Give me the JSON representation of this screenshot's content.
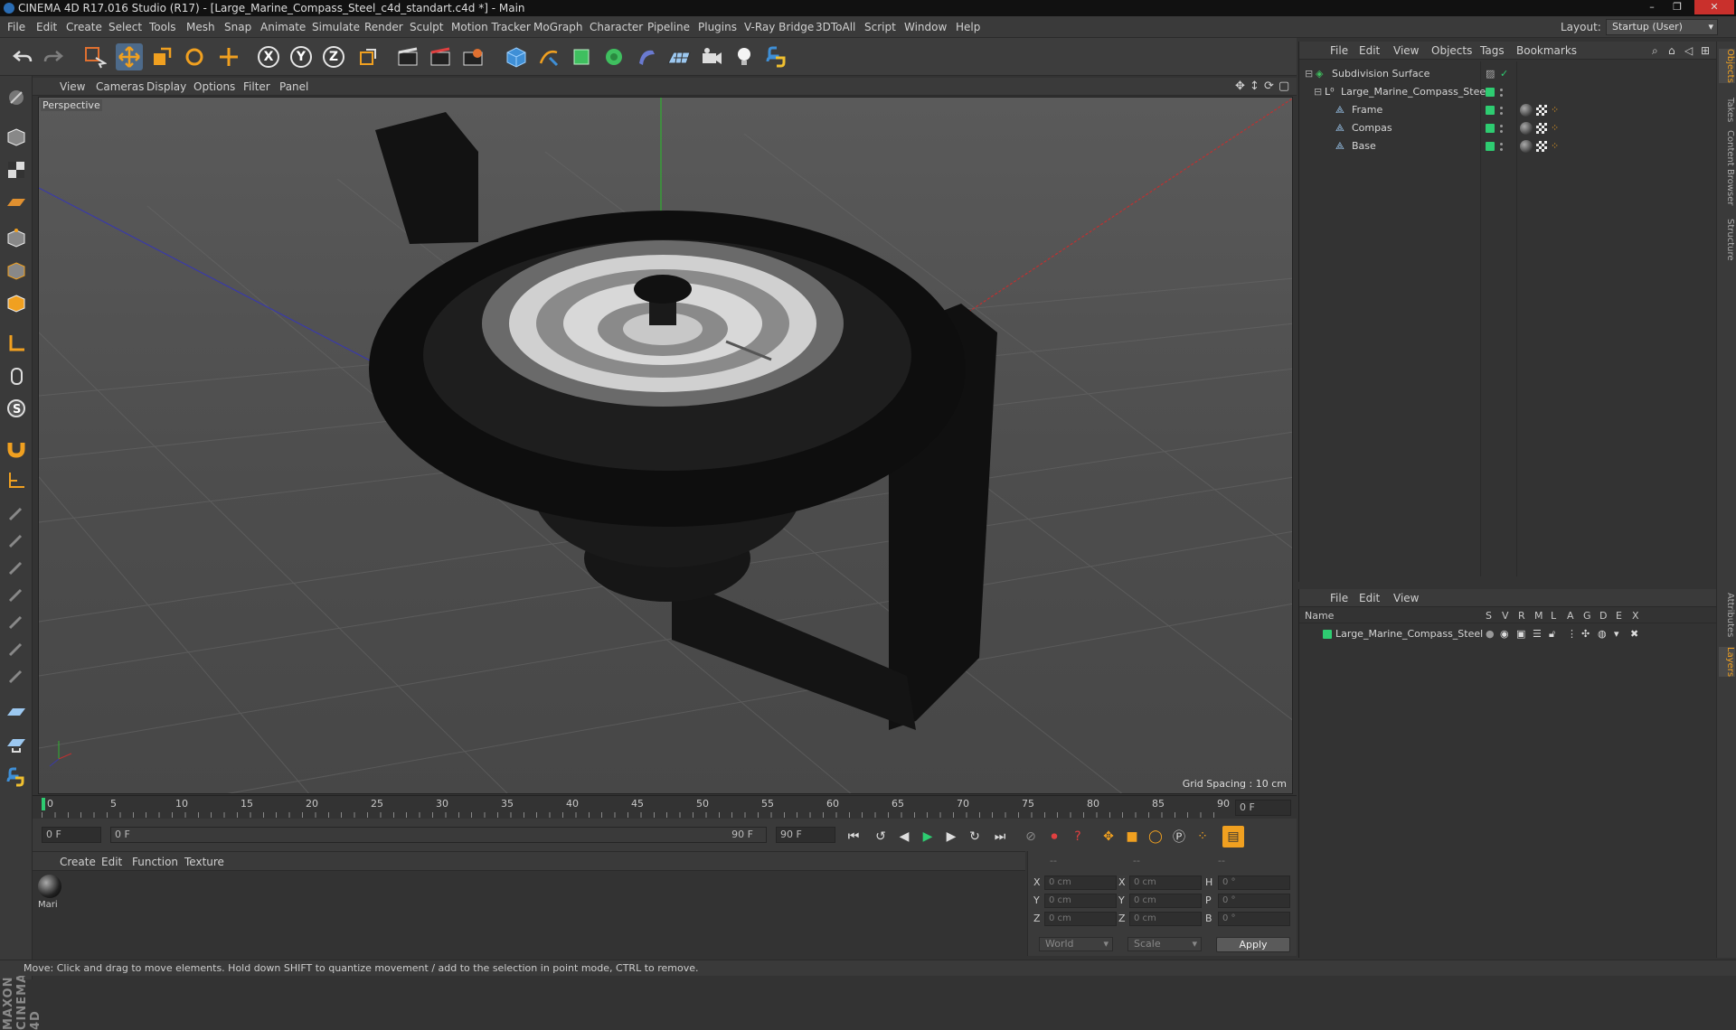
{
  "window": {
    "title": "CINEMA 4D R17.016 Studio (R17) - [Large_Marine_Compass_Steel_c4d_standart.c4d *] - Main",
    "minimize": "–",
    "restore": "❐",
    "close": "✕"
  },
  "menu": [
    "File",
    "Edit",
    "Create",
    "Select",
    "Tools",
    "Mesh",
    "Snap",
    "Animate",
    "Simulate",
    "Render",
    "Sculpt",
    "Motion Tracker",
    "MoGraph",
    "Character",
    "Pipeline",
    "Plugins",
    "V-Ray Bridge",
    "3DToAll",
    "Script",
    "Window",
    "Help"
  ],
  "layout": {
    "label": "Layout:",
    "value": "Startup (User)"
  },
  "toolbar": {
    "axis_x": "X",
    "axis_y": "Y",
    "axis_z": "Z"
  },
  "viewport": {
    "menu": [
      "View",
      "Cameras",
      "Display",
      "Options",
      "Filter",
      "Panel"
    ],
    "camera": "Perspective",
    "grid_spacing": "Grid Spacing : 10 cm"
  },
  "timeline": {
    "ticks": [
      "0",
      "5",
      "10",
      "15",
      "20",
      "25",
      "30",
      "35",
      "40",
      "45",
      "50",
      "55",
      "60",
      "65",
      "70",
      "75",
      "80",
      "85",
      "90"
    ],
    "current_frame": "0 F",
    "start_frame": "0 F",
    "range_start": "0 F",
    "range_end": "90 F",
    "end_frame": "90 F"
  },
  "material_manager": {
    "menu": [
      "Create",
      "Edit",
      "Function",
      "Texture"
    ],
    "materials": [
      {
        "name": "Mari"
      }
    ]
  },
  "coordinates": {
    "header": [
      "--",
      "--",
      "--"
    ],
    "rows": [
      {
        "a": "X",
        "av": "0 cm",
        "b": "X",
        "bv": "0 cm",
        "c": "H",
        "cv": "0 °"
      },
      {
        "a": "Y",
        "av": "0 cm",
        "b": "Y",
        "bv": "0 cm",
        "c": "P",
        "cv": "0 °"
      },
      {
        "a": "Z",
        "av": "0 cm",
        "b": "Z",
        "bv": "0 cm",
        "c": "B",
        "cv": "0 °"
      }
    ],
    "space": "World",
    "mode": "Scale",
    "apply": "Apply"
  },
  "object_manager": {
    "menu": [
      "File",
      "Edit",
      "View",
      "Objects",
      "Tags",
      "Bookmarks"
    ],
    "objects": [
      {
        "name": "Subdivision Surface"
      },
      {
        "name": "Large_Marine_Compass_Steel"
      },
      {
        "name": "Frame"
      },
      {
        "name": "Compas"
      },
      {
        "name": "Base"
      }
    ]
  },
  "layer_manager": {
    "menu": [
      "File",
      "Edit",
      "View"
    ],
    "columns": [
      "Name",
      "S",
      "V",
      "R",
      "M",
      "L",
      "A",
      "G",
      "D",
      "E",
      "X"
    ],
    "layers": [
      {
        "name": "Large_Marine_Compass_Steel"
      }
    ]
  },
  "right_tabs": [
    "Objects",
    "Takes",
    "Content Browser",
    "Structure",
    "Attributes",
    "Layers"
  ],
  "branding": "MAXON CINEMA 4D",
  "status": "Move: Click and drag to move elements. Hold down SHIFT to quantize movement / add to the selection in point mode, CTRL to remove.",
  "colors": {
    "accent": "#3f8fd6",
    "layer_green": "#2ecc71",
    "viewport_bg": "#555555"
  }
}
